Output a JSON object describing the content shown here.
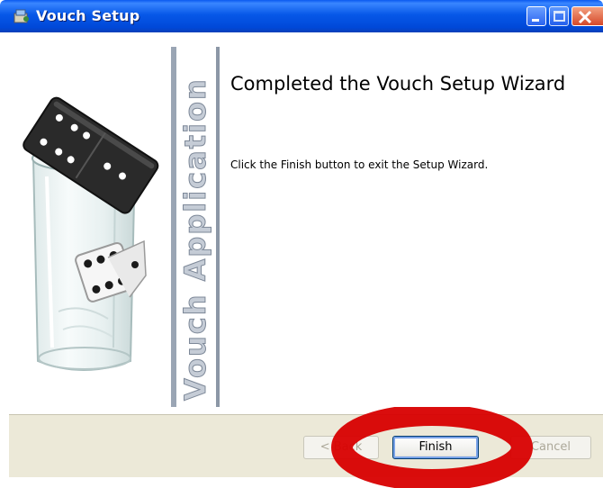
{
  "window": {
    "title": "Vouch Setup",
    "icon": "installer-icon"
  },
  "sidebar": {
    "vertical_label": "Vouch Application",
    "art": "domino-and-dice-in-glass"
  },
  "main": {
    "heading": "Completed the Vouch Setup Wizard",
    "description": "Click the Finish button to exit the Setup Wizard."
  },
  "buttons": {
    "back_label": "< Back",
    "finish_label": "Finish",
    "cancel_label": "Cancel"
  },
  "highlight": {
    "color": "#d80000",
    "target": "finish-button"
  }
}
